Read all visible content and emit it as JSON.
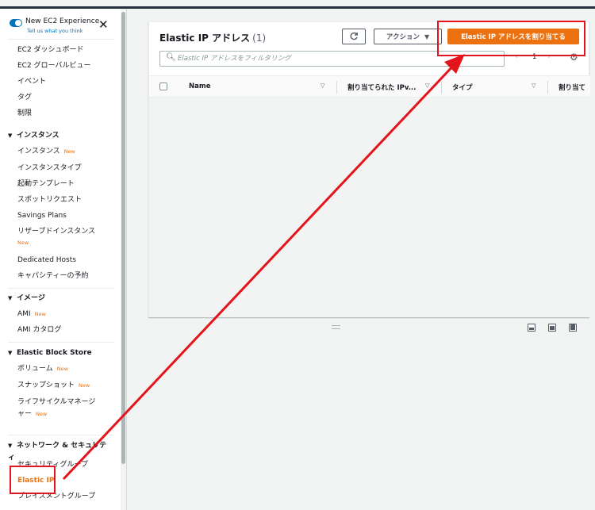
{
  "sidebar": {
    "experience_title": "New EC2 Experience",
    "experience_subtitle": "Tell us what you think",
    "new_badge": "New",
    "items": {
      "dashboard": "EC2 ダッシュボード",
      "global_view": "EC2 グローバルビュー",
      "events": "イベント",
      "tags": "タグ",
      "limits": "制限"
    },
    "instances": {
      "header": "インスタンス",
      "instances": "インスタンス",
      "instance_types": "インスタンスタイプ",
      "launch_templates": "起動テンプレート",
      "spot_requests": "スポットリクエスト",
      "savings_plans": "Savings Plans",
      "reserved_instances": "リザーブドインスタンス",
      "dedicated_hosts": "Dedicated Hosts",
      "capacity_reservations": "キャパシティーの予約"
    },
    "images": {
      "header": "イメージ",
      "ami": "AMI",
      "ami_catalog": "AMI カタログ"
    },
    "ebs": {
      "header": "Elastic Block Store",
      "volumes": "ボリューム",
      "snapshots": "スナップショット",
      "lifecycle_manager": "ライフサイクルマネージャー"
    },
    "network": {
      "header": "ネットワーク & セキュリティ",
      "security_groups": "セキュリティグループ",
      "elastic_ip": "Elastic IP",
      "placement_groups": "プレイスメントグループ"
    }
  },
  "main": {
    "title": "Elastic IP アドレス",
    "count": "(1)",
    "actions_label": "アクション",
    "allocate_label": "Elastic IP アドレスを割り当てる",
    "search_placeholder": "Elastic IP アドレスをフィルタリング",
    "page_number": "1",
    "columns": [
      "Name",
      "割り当てられた IPv...",
      "タイプ",
      "割り当て"
    ]
  },
  "colors": {
    "accent": "#ec7211",
    "link": "#0073bb",
    "annotation": "#e3141b"
  }
}
